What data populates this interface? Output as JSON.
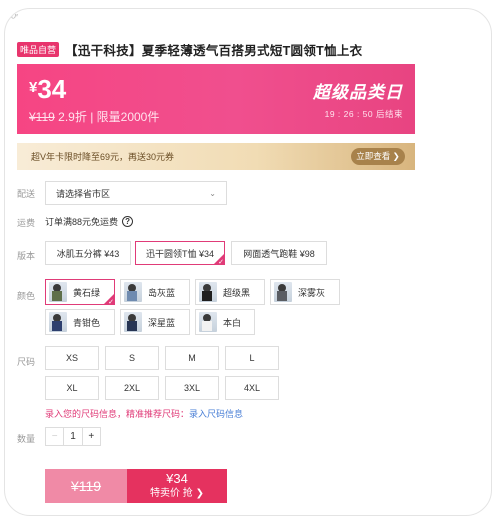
{
  "top_mark": "ᵁ'",
  "product": {
    "tag": "唯品自营",
    "title": "【迅干科技】夏季轻薄透气百搭男式短T圆领T恤上衣"
  },
  "price_banner": {
    "currency": "¥",
    "price": "34",
    "original_price": "¥119",
    "discount": "2.9折",
    "limit": "限量2000件",
    "event_title": "超级品类日",
    "countdown": "19 : 26 : 50  后结束",
    "colors": {
      "start": "#f64583",
      "end": "#e84481"
    }
  },
  "coupon": {
    "text": "超V年卡限时降至69元，再送30元券",
    "button_label": "立即查看 ❯"
  },
  "delivery": {
    "label": "配送",
    "placeholder": "请选择省市区"
  },
  "shipping": {
    "label": "运费",
    "text": "订单满88元免运费",
    "help_icon": "?"
  },
  "version": {
    "label": "版本",
    "options": [
      "冰肌五分裤 ¥43",
      "迅干圆领T恤 ¥34",
      "网面透气跑鞋 ¥98"
    ],
    "selected_index": 1
  },
  "color": {
    "label": "颜色",
    "options": [
      "黄石绿",
      "岛灰蓝",
      "超级黑",
      "深雾灰",
      "青钳色",
      "深星蓝",
      "本白"
    ],
    "selected_index": 0
  },
  "size": {
    "label": "尺码",
    "options": [
      "XS",
      "S",
      "M",
      "L",
      "XL",
      "2XL",
      "3XL",
      "4XL"
    ],
    "note": "录入您的尺码信息，精准推荐尺码：",
    "note_link": "录入尺码信息"
  },
  "quantity": {
    "label": "数量",
    "value": "1",
    "minus": "−",
    "plus": "+"
  },
  "buy": {
    "original_price": "¥119",
    "price": "¥34",
    "label": "特卖价 抢 ❯",
    "accent": "#e5325f"
  }
}
